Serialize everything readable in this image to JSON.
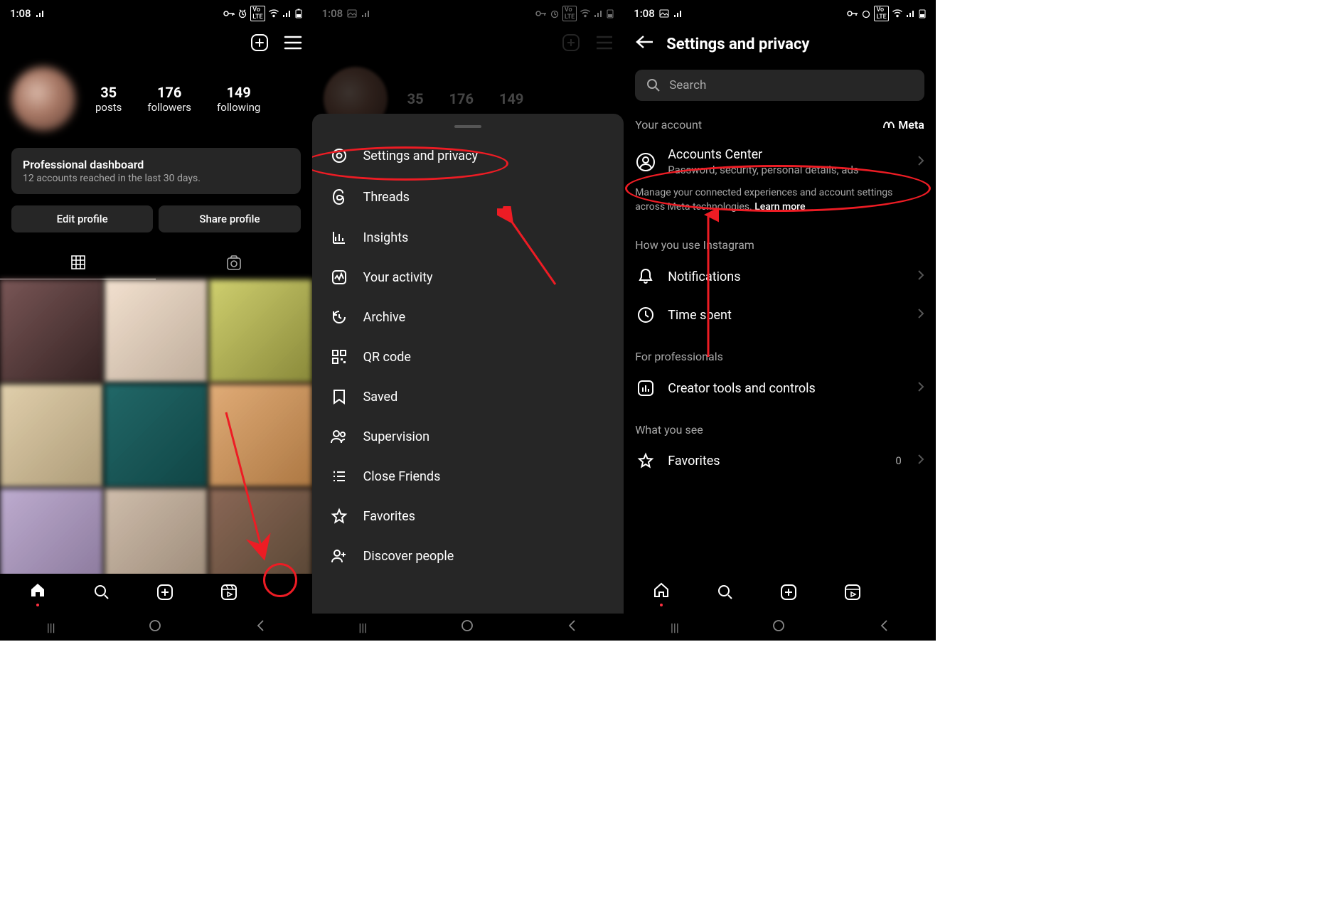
{
  "status": {
    "time": "1:08",
    "indicators": [
      "key",
      "alarm",
      "volte",
      "wifi",
      "signal",
      "battery"
    ]
  },
  "profile": {
    "posts_num": "35",
    "posts_label": "posts",
    "followers_num": "176",
    "followers_label": "followers",
    "following_num": "149",
    "following_label": "following"
  },
  "dashboard": {
    "title": "Professional dashboard",
    "subtitle": "12 accounts reached in the last 30 days."
  },
  "buttons": {
    "edit": "Edit profile",
    "share": "Share profile"
  },
  "menu": {
    "settings": "Settings and privacy",
    "threads": "Threads",
    "insights": "Insights",
    "activity": "Your activity",
    "archive": "Archive",
    "qr": "QR code",
    "saved": "Saved",
    "supervision": "Supervision",
    "close_friends": "Close Friends",
    "favorites": "Favorites",
    "discover": "Discover people"
  },
  "settings": {
    "title": "Settings and privacy",
    "search_placeholder": "Search",
    "your_account": "Your account",
    "meta": "Meta",
    "accounts_center": {
      "title": "Accounts Center",
      "subtitle": "Password, security, personal details, ads"
    },
    "hint_text": "Manage your connected experiences and account settings across Meta technologies. ",
    "learn_more": "Learn more",
    "how_you_use": "How you use Instagram",
    "notifications": "Notifications",
    "time_spent": "Time spent",
    "for_professionals": "For professionals",
    "creator_tools": "Creator tools and controls",
    "what_you_see": "What you see",
    "favorites": "Favorites",
    "favorites_count": "0"
  }
}
